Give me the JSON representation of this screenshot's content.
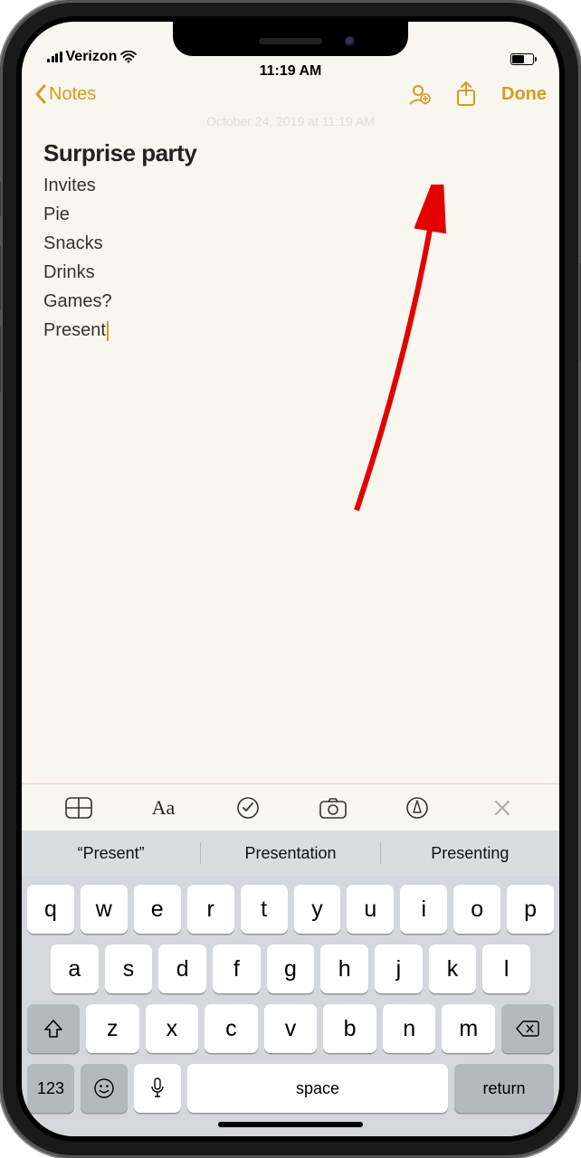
{
  "status": {
    "carrier": "Verizon",
    "time": "11:19 AM"
  },
  "nav": {
    "back_label": "Notes",
    "done_label": "Done"
  },
  "dim_date": "October 24, 2019 at 11:19 AM",
  "note": {
    "title": "Surprise party",
    "lines": [
      "Invites",
      "Pie",
      "Snacks",
      "Drinks",
      "Games?",
      "Present"
    ]
  },
  "suggestions": [
    "“Present”",
    "Presentation",
    "Presenting"
  ],
  "keyboard": {
    "row1": [
      "q",
      "w",
      "e",
      "r",
      "t",
      "y",
      "u",
      "i",
      "o",
      "p"
    ],
    "row2": [
      "a",
      "s",
      "d",
      "f",
      "g",
      "h",
      "j",
      "k",
      "l"
    ],
    "row3": [
      "z",
      "x",
      "c",
      "v",
      "b",
      "n",
      "m"
    ],
    "label123": "123",
    "space": "space",
    "return": "return"
  }
}
